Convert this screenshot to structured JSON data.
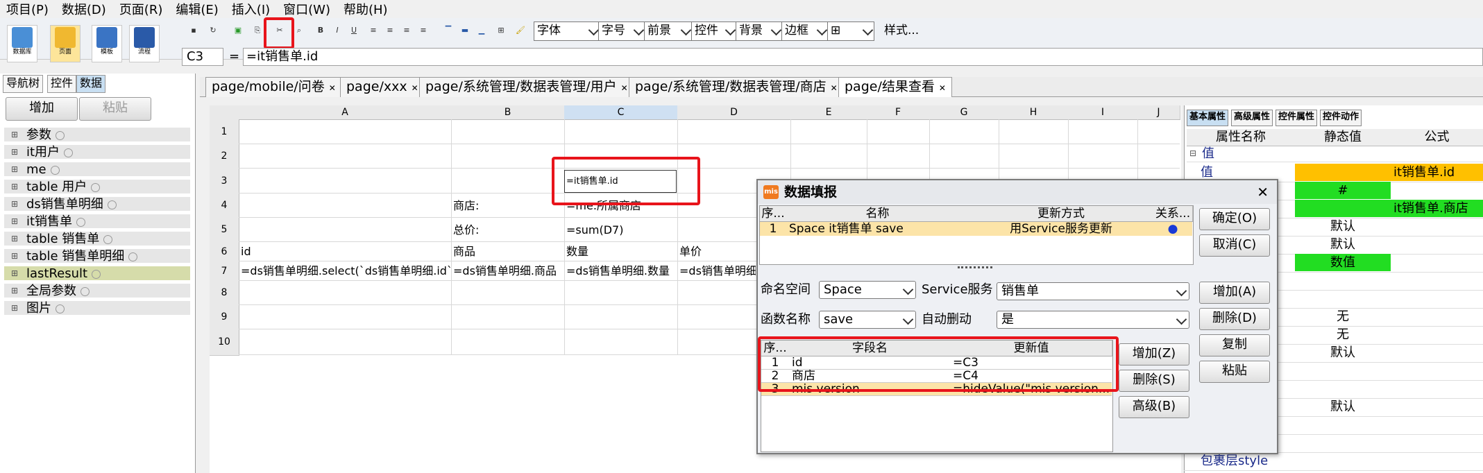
{
  "menu": [
    "项目(P)",
    "数据(D)",
    "页面(R)",
    "编辑(E)",
    "插入(I)",
    "窗口(W)",
    "帮助(H)"
  ],
  "toolbar": {
    "big_buttons": [
      "数据库",
      "页面",
      "模板",
      "流程"
    ],
    "font_label": "字体",
    "size_label": "字号",
    "fg_label": "前景",
    "control_label": "控件",
    "bg_label": "背景",
    "border_label": "边框",
    "style_label": "样式..."
  },
  "formula_bar": {
    "cell_ref": "C3",
    "equals": "=",
    "formula": "=it销售单.id"
  },
  "left_panel": {
    "tabs": [
      "导航树",
      "控件",
      "数据"
    ],
    "add_button": "增加",
    "paste_button": "粘贴",
    "tree": [
      "参数",
      "it用户",
      "me",
      "table 用户",
      "ds销售单明细",
      "it销售单",
      "table 销售单",
      "table 销售单明细",
      "lastResult",
      "全局参数",
      "图片"
    ]
  },
  "doc_tabs": [
    "page/mobile/问卷",
    "page/xxx",
    "page/系统管理/数据表管理/用户",
    "page/系统管理/数据表管理/商店",
    "page/结果查看"
  ],
  "grid": {
    "columns": [
      "A",
      "B",
      "C",
      "D",
      "E",
      "F",
      "G",
      "H",
      "I",
      "J"
    ],
    "rows": [
      "1",
      "2",
      "3",
      "4",
      "5",
      "6",
      "7",
      "8",
      "9",
      "10"
    ],
    "cells": {
      "C3": "=it销售单.id",
      "B4": "商店:",
      "C4": "=me.所属商店",
      "B5": "总价:",
      "C5": "=sum(D7)",
      "A6": "id",
      "B6": "商品",
      "C6": "数量",
      "D6": "单价",
      "A7": "=ds销售单明细.select(`ds销售单明细.id`)",
      "B7": "=ds销售单明细.商品",
      "C7": "=ds销售单明细.数量",
      "D7": "=ds销售单明细."
    }
  },
  "right_panel": {
    "tabs": [
      "基本属性",
      "高级属性",
      "控件属性",
      "控件动作"
    ],
    "headers": [
      "属性名称",
      "静态值",
      "公式"
    ],
    "group": "值",
    "rows": [
      {
        "name": "值",
        "static": "",
        "formula": "it销售单.id",
        "color": "#ffc000"
      },
      {
        "name": "",
        "static": "#",
        "formula": "",
        "color": "#22dd22"
      },
      {
        "name": "",
        "static": "",
        "formula": "it销售单.商店",
        "color": "#22dd22"
      },
      {
        "name": "",
        "static": "默认",
        "formula": "",
        "color": ""
      },
      {
        "name": "",
        "static": "默认",
        "formula": "",
        "color": ""
      },
      {
        "name": "",
        "static": "数值",
        "formula": "",
        "color": "#22dd22"
      },
      {
        "name": "",
        "static": "",
        "formula": "",
        "color": ""
      },
      {
        "name": "",
        "static": "",
        "formula": "",
        "color": ""
      },
      {
        "name": "",
        "static": "无",
        "formula": "",
        "color": ""
      },
      {
        "name": "",
        "static": "无",
        "formula": "",
        "color": ""
      },
      {
        "name": "",
        "static": "默认",
        "formula": "",
        "color": ""
      },
      {
        "name": "",
        "static": "",
        "formula": "",
        "color": ""
      },
      {
        "name": "",
        "static": "",
        "formula": "",
        "color": ""
      },
      {
        "name": "",
        "static": "默认",
        "formula": "",
        "color": ""
      },
      {
        "name": "",
        "static": "",
        "formula": "",
        "color": ""
      },
      {
        "name": "",
        "static": "",
        "formula": "",
        "color": ""
      },
      {
        "name": "包裹层style",
        "static": "",
        "formula": "",
        "color": ""
      }
    ]
  },
  "dialog": {
    "title": "数据填报",
    "close": "✕",
    "top_table": {
      "headers": [
        "序...",
        "名称",
        "更新方式",
        "关系..."
      ],
      "rows": [
        [
          "1",
          "Space it销售单 save",
          "用Service服务更新",
          "●"
        ]
      ]
    },
    "ok_button": "确定(O)",
    "cancel_button": "取消(C)",
    "add_button": "增加(A)",
    "delete_button": "删除(D)",
    "copy_button": "复制",
    "paste_button": "粘贴",
    "namespace_label": "命名空间",
    "namespace_value": "Space",
    "service_label": "Service服务",
    "service_value": "销售单",
    "function_label": "函数名称",
    "function_value": "save",
    "autolink_label": "自动删动",
    "autolink_value": "是",
    "field_table": {
      "headers": [
        "序...",
        "字段名",
        "更新值"
      ],
      "rows": [
        [
          "1",
          "id",
          "=C3"
        ],
        [
          "2",
          "商店",
          "=C4"
        ],
        [
          "3",
          "mis version",
          "=hideValue(\"mis version..."
        ]
      ]
    },
    "field_add": "增加(Z)",
    "field_delete": "删除(S)",
    "field_advanced": "高级(B)"
  }
}
